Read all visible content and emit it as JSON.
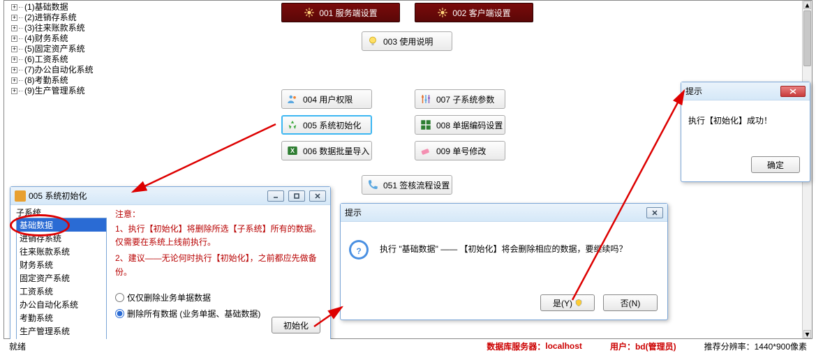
{
  "tree": [
    "(1)基础数据",
    "(2)进销存系统",
    "(3)往来账款系统",
    "(4)财务系统",
    "(5)固定资产系统",
    "(6)工资系统",
    "(7)办公自动化系统",
    "(8)考勤系统",
    "(9)生产管理系统"
  ],
  "big1": "001 服务端设置",
  "big2": "002 客户端设置",
  "b003": "003 使用说明",
  "b004": "004 用户权限",
  "b005": "005 系统初始化",
  "b006": "006 数据批量导入",
  "b007": "007 子系统参数",
  "b008": "008 单据编码设置",
  "b009": "009 单号修改",
  "b051": "051 签核流程设置",
  "initDlg": {
    "title": "005 系统初始化",
    "leftLabel": "子系统",
    "items": [
      "基础数据",
      "进销存系统",
      "往来账款系统",
      "财务系统",
      "固定资产系统",
      "工资系统",
      "办公自动化系统",
      "考勤系统",
      "生产管理系统"
    ],
    "noticeTitle": "注意：",
    "notice1": "1、执行【初始化】将删除所选【子系统】所有的数据。仅需要在系统上线前执行。",
    "notice2": "2、建议——无论何时执行【初始化】，之前都应先做备份。",
    "radio1": "仅仅删除业务单据数据",
    "radio2": "删除所有数据 (业务单据、基础数据)",
    "btn": "初始化"
  },
  "confirmDlg": {
    "title": "提示",
    "msg": "执行 \"基础数据\" —— 【初始化】将会删除相应的数据，要继续吗？",
    "yes": "是(Y)",
    "no": "否(N)"
  },
  "okDlg": {
    "title": "提示",
    "msg": "执行【初始化】成功！",
    "ok": "确定"
  },
  "status": {
    "ready": "就绪",
    "dbLabel": "数据库服务器：",
    "dbVal": "localhost",
    "userLabel": "用户：",
    "userVal": "bd(管理员)",
    "res": "推荐分辨率：1440*900像素"
  }
}
